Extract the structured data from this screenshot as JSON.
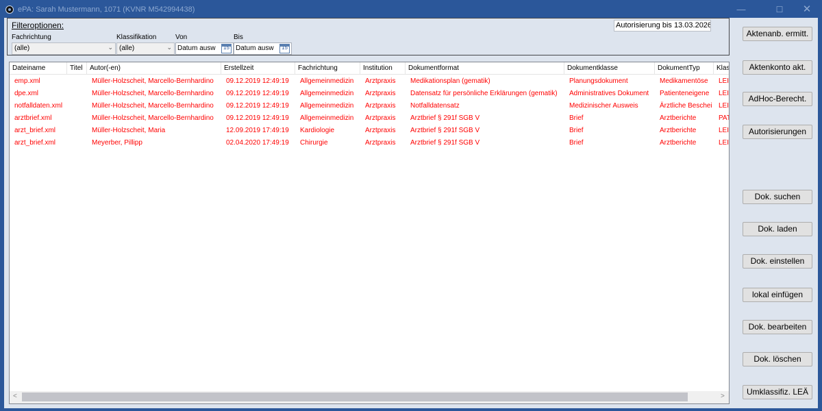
{
  "window": {
    "title": "ePA: Sarah Mustermann, 1071 (KVNR M542994438)",
    "controls": {
      "minimize": "—",
      "maximize": "☐",
      "close": "✕"
    }
  },
  "filter": {
    "heading": "Filteroptionen:",
    "authorization": "Autorisierung bis 13.03.2026",
    "fachrichtung": {
      "label": "Fachrichtung",
      "value": "(alle)"
    },
    "klassifikation": {
      "label": "Klassifikation",
      "value": "(alle)"
    },
    "von": {
      "label": "Von",
      "placeholder": "Datum ausw",
      "calendar_day": "15"
    },
    "bis": {
      "label": "Bis",
      "placeholder": "Datum ausw",
      "calendar_day": "15"
    }
  },
  "table": {
    "columns": [
      "Dateiname",
      "Titel",
      "Autor(-en)",
      "Erstellzeit",
      "Fachrichtung",
      "Institution",
      "Dokumentformat",
      "Dokumentklasse",
      "DokumentTyp",
      "Klas"
    ],
    "rows": [
      [
        "emp.xml",
        "",
        "Müller-Holzscheit, Marcello-Bernhardino",
        "09.12.2019 12:49:19",
        "Allgemeinmedizin",
        "Arztpraxis",
        "Medikationsplan (gematik)",
        "Planungsdokument",
        "Medikamentöse",
        "LEI"
      ],
      [
        "dpe.xml",
        "",
        "Müller-Holzscheit, Marcello-Bernhardino",
        "09.12.2019 12:49:19",
        "Allgemeinmedizin",
        "Arztpraxis",
        "Datensatz für persönliche Erklärungen (gematik)",
        "Administratives Dokument",
        "Patienteneigene",
        "LEI"
      ],
      [
        "notfalldaten.xml",
        "",
        "Müller-Holzscheit, Marcello-Bernhardino",
        "09.12.2019 12:49:19",
        "Allgemeinmedizin",
        "Arztpraxis",
        "Notfalldatensatz",
        "Medizinischer Ausweis",
        "Ärztliche Beschei",
        "LEI"
      ],
      [
        "arztbrief.xml",
        "",
        "Müller-Holzscheit, Marcello-Bernhardino",
        "09.12.2019 12:49:19",
        "Allgemeinmedizin",
        "Arztpraxis",
        "Arztbrief § 291f SGB V",
        "Brief",
        "Arztberichte",
        "PAT"
      ],
      [
        "arzt_brief.xml",
        "",
        "Müller-Holzscheit, Maria",
        "12.09.2019 17:49:19",
        "Kardiologie",
        "Arztpraxis",
        "Arztbrief § 291f SGB V",
        "Brief",
        "Arztberichte",
        "LEI"
      ],
      [
        "arzt_brief.xml",
        "",
        "Meyerber, Pillipp",
        "02.04.2020 17:49:19",
        "Chirurgie",
        "Arztpraxis",
        "Arztbrief § 291f SGB V",
        "Brief",
        "Arztberichte",
        "LEI"
      ]
    ],
    "text_color": "#ff0000",
    "scroll_left": "<",
    "scroll_right": ">"
  },
  "buttons": [
    "Aktenanb. ermitt.",
    "Aktenkonto akt.",
    "AdHoc-Berecht.",
    "Autorisierungen",
    "Dok. suchen",
    "Dok. laden",
    "Dok. einstellen",
    "lokal einfügen",
    "Dok. bearbeiten",
    "Dok. löschen",
    "Umklassifiz. LEÄ"
  ]
}
